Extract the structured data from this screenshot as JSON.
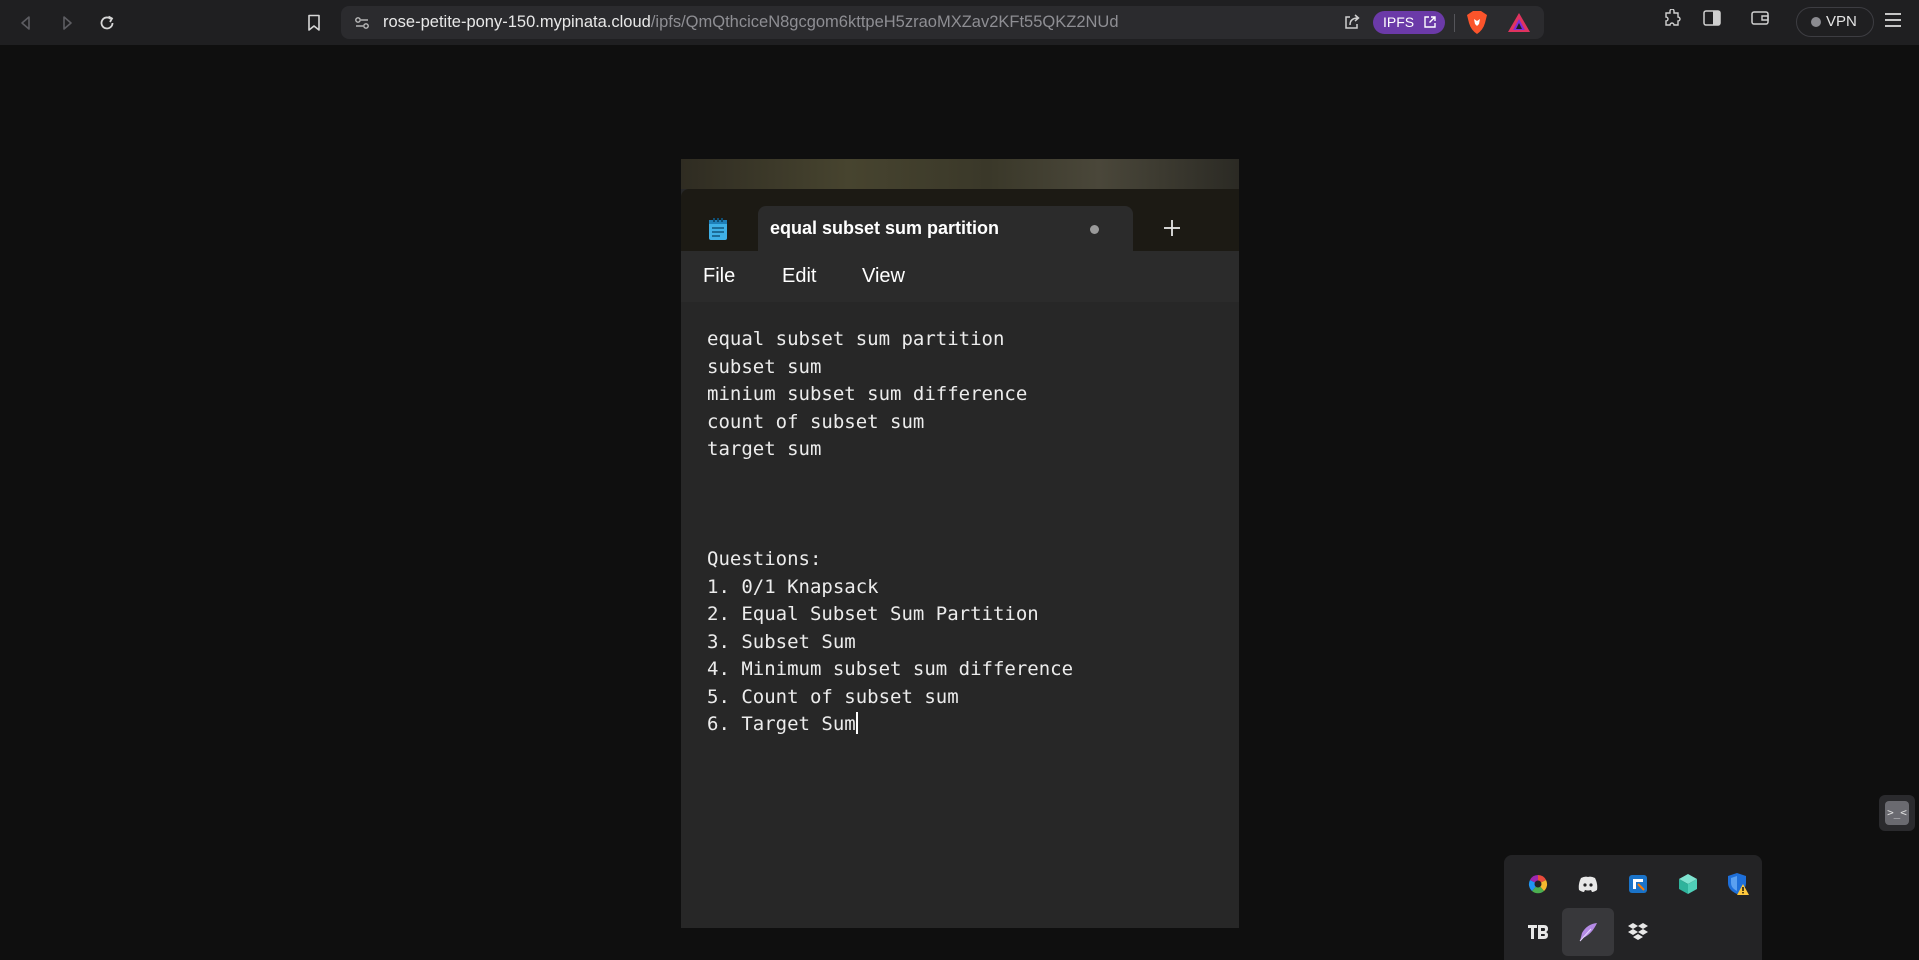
{
  "browser": {
    "url_host": "rose-petite-pony-150.mypinata.cloud",
    "url_path": "/ipfs/QmQthciceN8gcgom6kttpeH5zraoMXZav2KFt55QKZ2NUd",
    "ipfs_label": "IPFS",
    "vpn_label": "VPN",
    "icons": [
      "back-icon",
      "forward-icon",
      "reload-icon",
      "bookmark-icon",
      "site-settings-icon",
      "share-icon",
      "brave-shields-icon",
      "brave-rewards-icon",
      "extensions-icon",
      "sidebar-icon",
      "wallet-icon",
      "menu-icon"
    ]
  },
  "notepad": {
    "tab_title": "equal subset sum partition",
    "menu": [
      "File",
      "Edit",
      "View"
    ],
    "lines": [
      "equal subset sum partition",
      "subset sum",
      "minium subset sum difference",
      "count of subset sum",
      "target sum",
      "",
      "",
      "",
      "Questions:",
      "1. 0/1 Knapsack",
      "2. Equal Subset Sum Partition",
      "3. Subset Sum",
      "4. Minimum subset sum difference",
      "5. Count of subset sum",
      "6. Target Sum"
    ]
  },
  "side_widget": {
    "glyph": ">_<"
  },
  "tray": {
    "icons": [
      "color-wheel-icon",
      "discord-icon",
      "snipping-tool-icon",
      "cube-app-icon",
      "defender-warning-icon",
      "tb-app-icon",
      "pen-feather-icon",
      "dropbox-icon"
    ]
  },
  "colors": {
    "page_bg": "#0f0f0f",
    "chrome_bg": "#1f1f21",
    "ipfs_purple": "#6b3aa8",
    "notepad_bg": "#272727"
  }
}
